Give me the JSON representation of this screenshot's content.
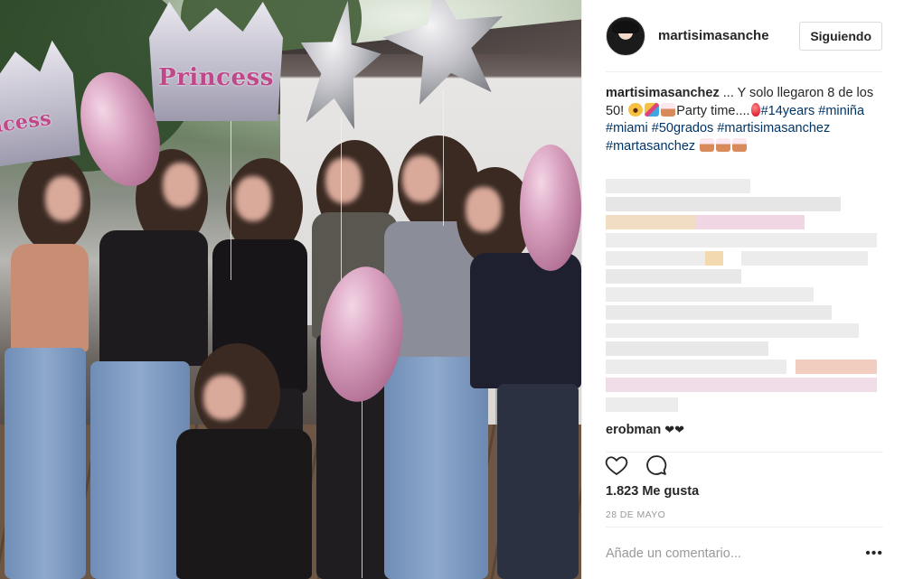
{
  "header": {
    "username": "martisimasanche",
    "follow_label": "Siguiendo"
  },
  "caption": {
    "username": "martisimasanchez",
    "text_before_emoji": "... Y solo llegaron 8 de los 50!",
    "text_after_emoji": "Party time....",
    "hashtags": [
      "#14years",
      "#miniña",
      "#miami",
      "#50grados",
      "#martisimasanchez",
      "#martasanchez"
    ]
  },
  "photo": {
    "balloon_text": "Princess"
  },
  "comment": {
    "username": "erobman",
    "text": "❤❤"
  },
  "likes": "1.823 Me gusta",
  "date": "28 DE MAYO",
  "add_comment": {
    "placeholder": "Añade un comentario...",
    "more_label": "•••"
  },
  "icons": {
    "like": "heart-icon",
    "comment": "comment-bubble-icon",
    "more": "more-options-icon"
  },
  "colors": {
    "hashtag": "#003569",
    "text": "#262626",
    "secondary": "#999999",
    "border": "#efefef"
  }
}
